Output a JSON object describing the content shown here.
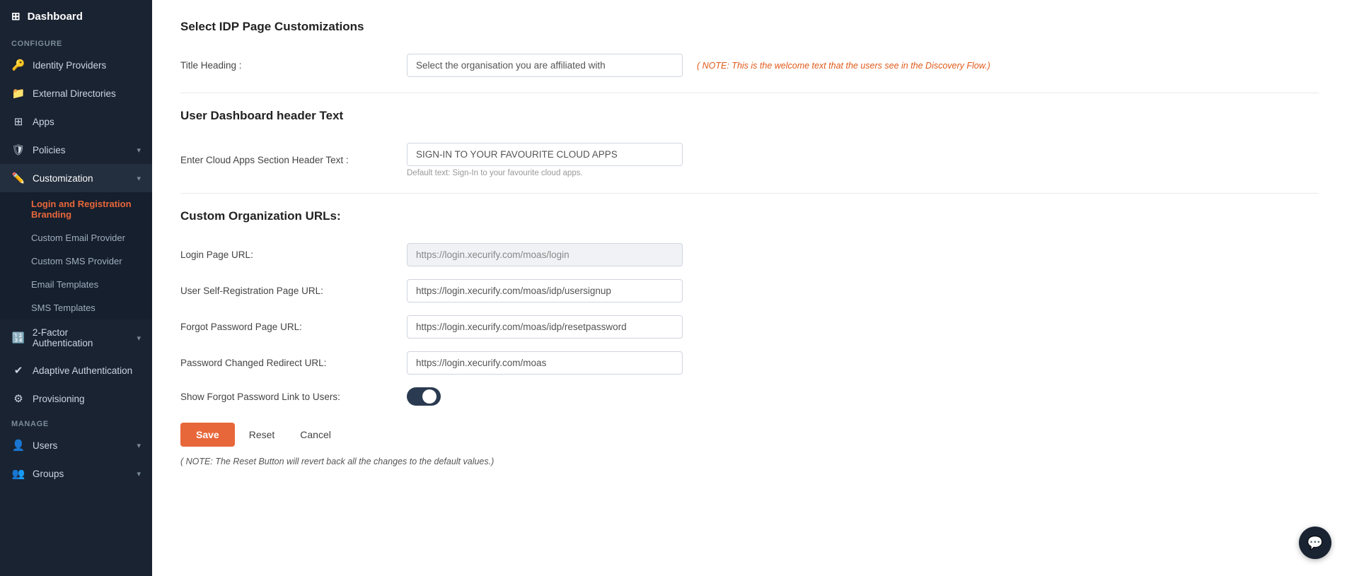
{
  "sidebar": {
    "header_label": "Dashboard",
    "header_icon": "⊞",
    "sections": [
      {
        "label": "Configure",
        "items": [
          {
            "id": "identity-providers",
            "label": "Identity Providers",
            "icon": "🔑",
            "chevron": false
          },
          {
            "id": "external-directories",
            "label": "External Directories",
            "icon": "📁",
            "chevron": false
          },
          {
            "id": "apps",
            "label": "Apps",
            "icon": "⊞",
            "chevron": false
          },
          {
            "id": "policies",
            "label": "Policies",
            "icon": "🛡",
            "chevron": true
          },
          {
            "id": "customization",
            "label": "Customization",
            "icon": "✏️",
            "chevron": true,
            "active": true
          }
        ]
      }
    ],
    "customization_submenu": [
      {
        "id": "login-branding",
        "label": "Login and Registration Branding",
        "active": true
      },
      {
        "id": "custom-email-provider",
        "label": "Custom Email Provider",
        "active": false
      },
      {
        "id": "custom-sms-provider",
        "label": "Custom SMS Provider",
        "active": false
      },
      {
        "id": "email-templates",
        "label": "Email Templates",
        "active": false
      },
      {
        "id": "sms-templates",
        "label": "SMS Templates",
        "active": false
      }
    ],
    "bottom_items": [
      {
        "id": "two-factor",
        "label": "2-Factor Authentication",
        "icon": "🔢",
        "chevron": true
      },
      {
        "id": "adaptive-auth",
        "label": "Adaptive Authentication",
        "icon": "✔",
        "chevron": false
      },
      {
        "id": "provisioning",
        "label": "Provisioning",
        "icon": "⚙",
        "chevron": false
      }
    ],
    "manage_section_label": "Manage",
    "manage_items": [
      {
        "id": "users",
        "label": "Users",
        "icon": "👤",
        "chevron": true
      },
      {
        "id": "groups",
        "label": "Groups",
        "icon": "👥",
        "chevron": true
      }
    ]
  },
  "main": {
    "select_idp_title": "Select IDP Page Customizations",
    "title_heading_label": "Title Heading :",
    "title_heading_value": "Select the organisation you are affiliated with",
    "title_heading_note": "( NOTE: This is the welcome text that the users see in the Discovery Flow.)",
    "user_dashboard_title": "User Dashboard header Text",
    "cloud_apps_label": "Enter Cloud Apps Section Header Text :",
    "cloud_apps_value": "SIGN-IN TO YOUR FAVOURITE CLOUD APPS",
    "cloud_apps_hint": "Default text: Sign-In to your favourite cloud apps.",
    "custom_org_title": "Custom Organization URLs:",
    "login_url_label": "Login Page URL:",
    "login_url_value": "https://login.xecurify.com/moas/login",
    "self_reg_label": "User Self-Registration Page URL:",
    "self_reg_value": "https://login.xecurify.com/moas/idp/usersignup",
    "forgot_pwd_label": "Forgot Password Page URL:",
    "forgot_pwd_value": "https://login.xecurify.com/moas/idp/resetpassword",
    "pwd_changed_label": "Password Changed Redirect URL:",
    "pwd_changed_value": "https://login.xecurify.com/moas",
    "show_forgot_label": "Show Forgot Password Link to Users:",
    "save_label": "Save",
    "reset_label": "Reset",
    "cancel_label": "Cancel",
    "bottom_note": "( NOTE: The Reset Button will revert back all the changes to the default values.)"
  }
}
